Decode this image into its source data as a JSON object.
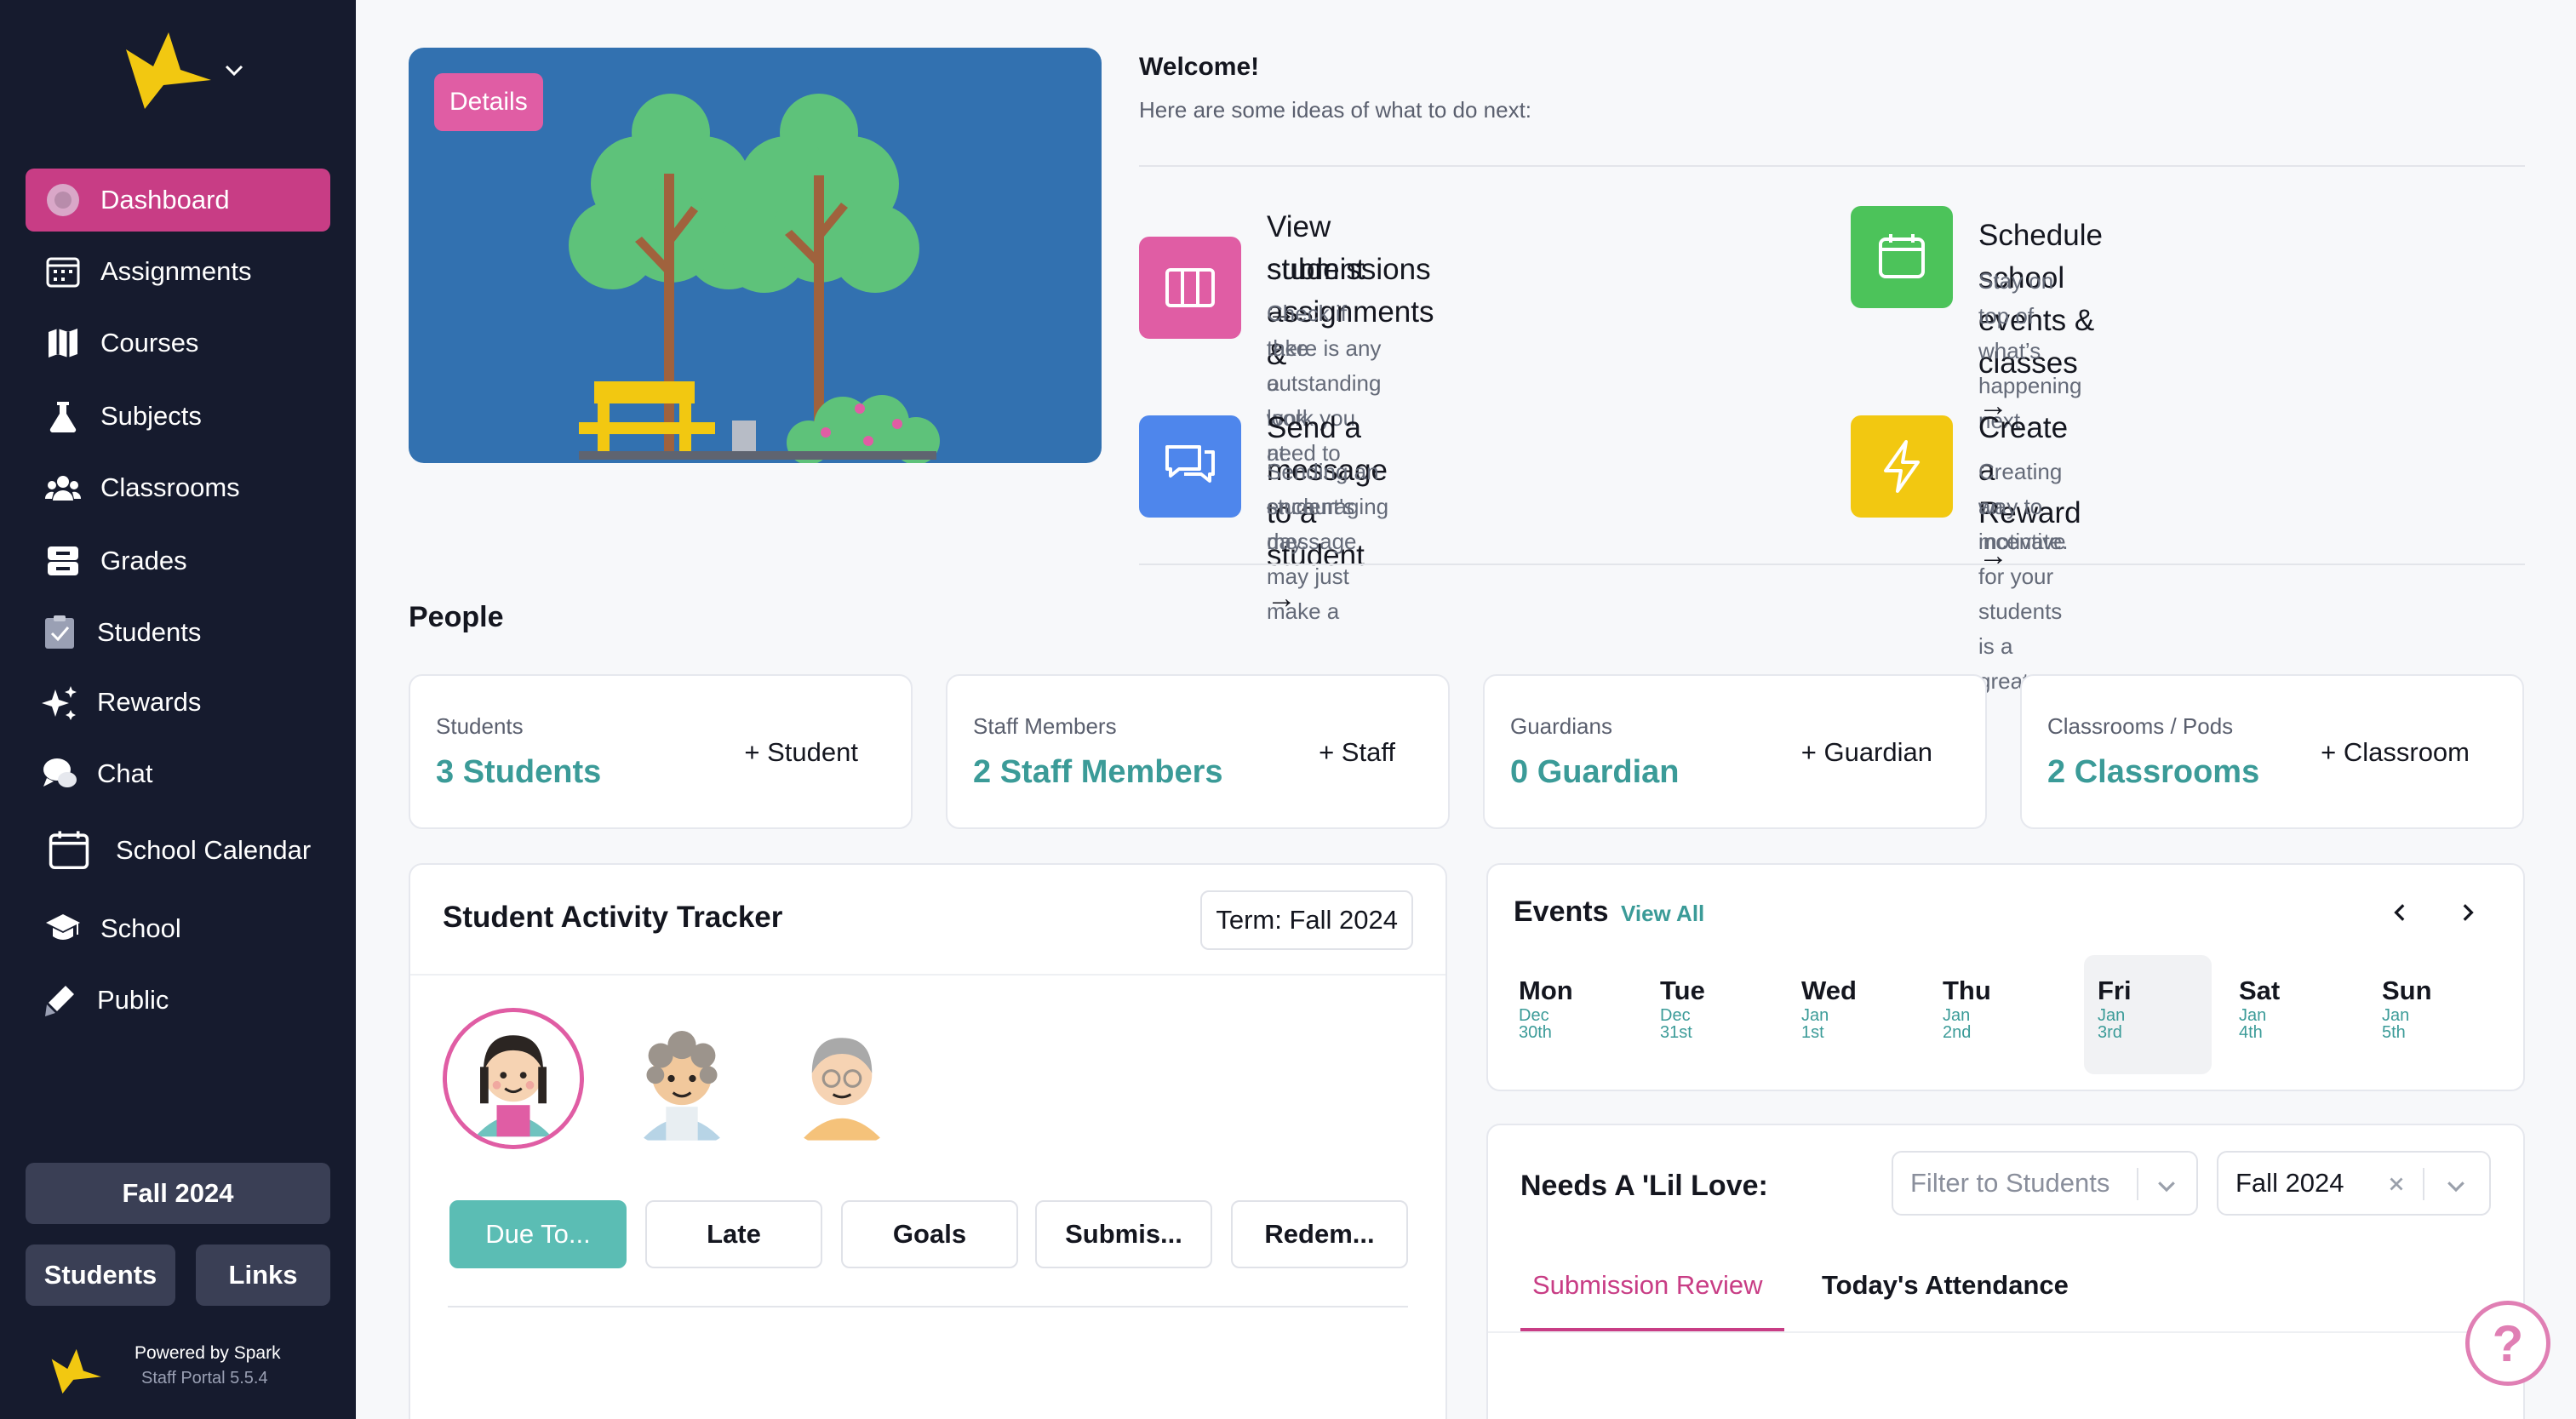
{
  "sidebar": {
    "items": [
      {
        "label": "Dashboard",
        "icon": "dashboard-icon"
      },
      {
        "label": "Assignments",
        "icon": "calendar-grid-icon"
      },
      {
        "label": "Courses",
        "icon": "map-icon"
      },
      {
        "label": "Subjects",
        "icon": "flask-icon"
      },
      {
        "label": "Classrooms",
        "icon": "users-icon"
      },
      {
        "label": "Grades",
        "icon": "inbox-stack-icon"
      },
      {
        "label": "Students",
        "icon": "clipboard-check-icon"
      },
      {
        "label": "Rewards",
        "icon": "sparkles-icon"
      },
      {
        "label": "Chat",
        "icon": "chat-bubbles-icon"
      },
      {
        "label": "School Calendar",
        "icon": "calendar-icon"
      },
      {
        "label": "School",
        "icon": "graduation-cap-icon"
      },
      {
        "label": "Public",
        "icon": "pen-icon"
      }
    ],
    "term": "Fall 2024",
    "students_btn": "Students",
    "links_btn": "Links",
    "powered_by": "Powered by Spark",
    "version": "Staff Portal 5.5.4"
  },
  "hero": {
    "details": "Details"
  },
  "welcome": {
    "title": "Welcome!",
    "subtitle": "Here are some ideas of what to do next:"
  },
  "ideas": [
    {
      "title1": "View student assignments &",
      "title2": "submissions →",
      "desc1": "Check if there is any outstanding work you need to",
      "desc2": "take a look at.",
      "color": "#e05da4",
      "icon": "columns-icon"
    },
    {
      "title1": "Schedule school events & classes →",
      "desc1": "Stay on top of what’s happening next.",
      "color": "#4cc35a",
      "icon": "calendar-icon"
    },
    {
      "title1": "Send a message to a student →",
      "desc1": "Sending an encouraging message may just make a",
      "desc2": "student's day.",
      "color": "#4e86ec",
      "icon": "chat-bubbles-icon"
    },
    {
      "title1": "Create a Reward →",
      "desc1": "Creating an incentive for your students is a great",
      "desc2": "way to motivate.",
      "color": "#f2c811",
      "icon": "bolt-icon"
    }
  ],
  "people": {
    "title": "People",
    "cards": [
      {
        "label": "Students",
        "value": "3 Students",
        "add": "+ Student"
      },
      {
        "label": "Staff Members",
        "value": "2 Staff Members",
        "add": "+ Staff"
      },
      {
        "label": "Guardians",
        "value": "0 Guardian",
        "add": "+ Guardian"
      },
      {
        "label": "Classrooms / Pods",
        "value": "2 Classrooms",
        "add": "+ Classroom"
      }
    ]
  },
  "tracker": {
    "title": "Student Activity Tracker",
    "term": "Term: Fall 2024",
    "tabs": [
      "Due To...",
      "Late",
      "Goals",
      "Submis...",
      "Redem..."
    ]
  },
  "events": {
    "title": "Events",
    "view_all": "View All",
    "days": [
      {
        "name": "Mon",
        "month": "Dec",
        "date": "30th"
      },
      {
        "name": "Tue",
        "month": "Dec",
        "date": "31st"
      },
      {
        "name": "Wed",
        "month": "Jan",
        "date": "1st"
      },
      {
        "name": "Thu",
        "month": "Jan",
        "date": "2nd"
      },
      {
        "name": "Fri",
        "month": "Jan",
        "date": "3rd"
      },
      {
        "name": "Sat",
        "month": "Jan",
        "date": "4th"
      },
      {
        "name": "Sun",
        "month": "Jan",
        "date": "5th"
      }
    ]
  },
  "love": {
    "title": "Needs A 'Lil Love:",
    "filter_placeholder": "Filter to Students",
    "term_value": "Fall 2024",
    "tabs": [
      "Submission Review",
      "Today's Attendance"
    ]
  },
  "help": "?",
  "colors": {
    "sidebar": "#161b2e",
    "accent": "#c83d85",
    "teal": "#3b9b98"
  }
}
